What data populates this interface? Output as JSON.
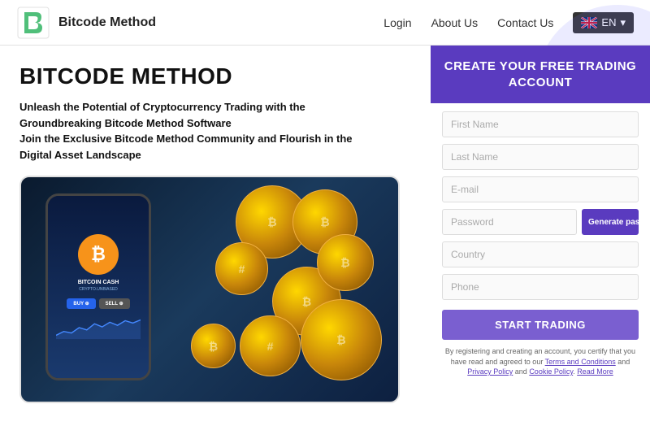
{
  "header": {
    "logo_text": "Bitcode\nMethod",
    "nav": {
      "login": "Login",
      "about": "About Us",
      "contact": "Contact Us",
      "lang": "EN"
    }
  },
  "hero": {
    "title": "BITCODE METHOD",
    "subtitle_line1": "Unleash the Potential of Cryptocurrency Trading with the",
    "subtitle_line2": "Groundbreaking Bitcode Method Software",
    "subtitle_line3": "Join the Exclusive Bitcode Method Community and Flourish in the",
    "subtitle_line4": "Digital Asset Landscape"
  },
  "phone": {
    "coin_name": "BITCOIN CASH",
    "coin_sub": "CRYPTO.UNBIASED",
    "buy_label": "BUY ⊕",
    "sell_label": "SELL ⊕"
  },
  "form": {
    "header": "CREATE YOUR FREE TRADING ACCOUNT",
    "first_name_placeholder": "First Name",
    "last_name_placeholder": "Last Name",
    "email_placeholder": "E-mail",
    "password_placeholder": "Password",
    "generate_btn": "Generate passwords",
    "country_placeholder": "Country",
    "phone_placeholder": "Phone",
    "start_btn": "START TRADING",
    "disclaimer": "By registering and creating an account, you certify that you have read and agreed to our Terms and Conditions and Privacy Policy and Cookie Policy. Read More"
  }
}
